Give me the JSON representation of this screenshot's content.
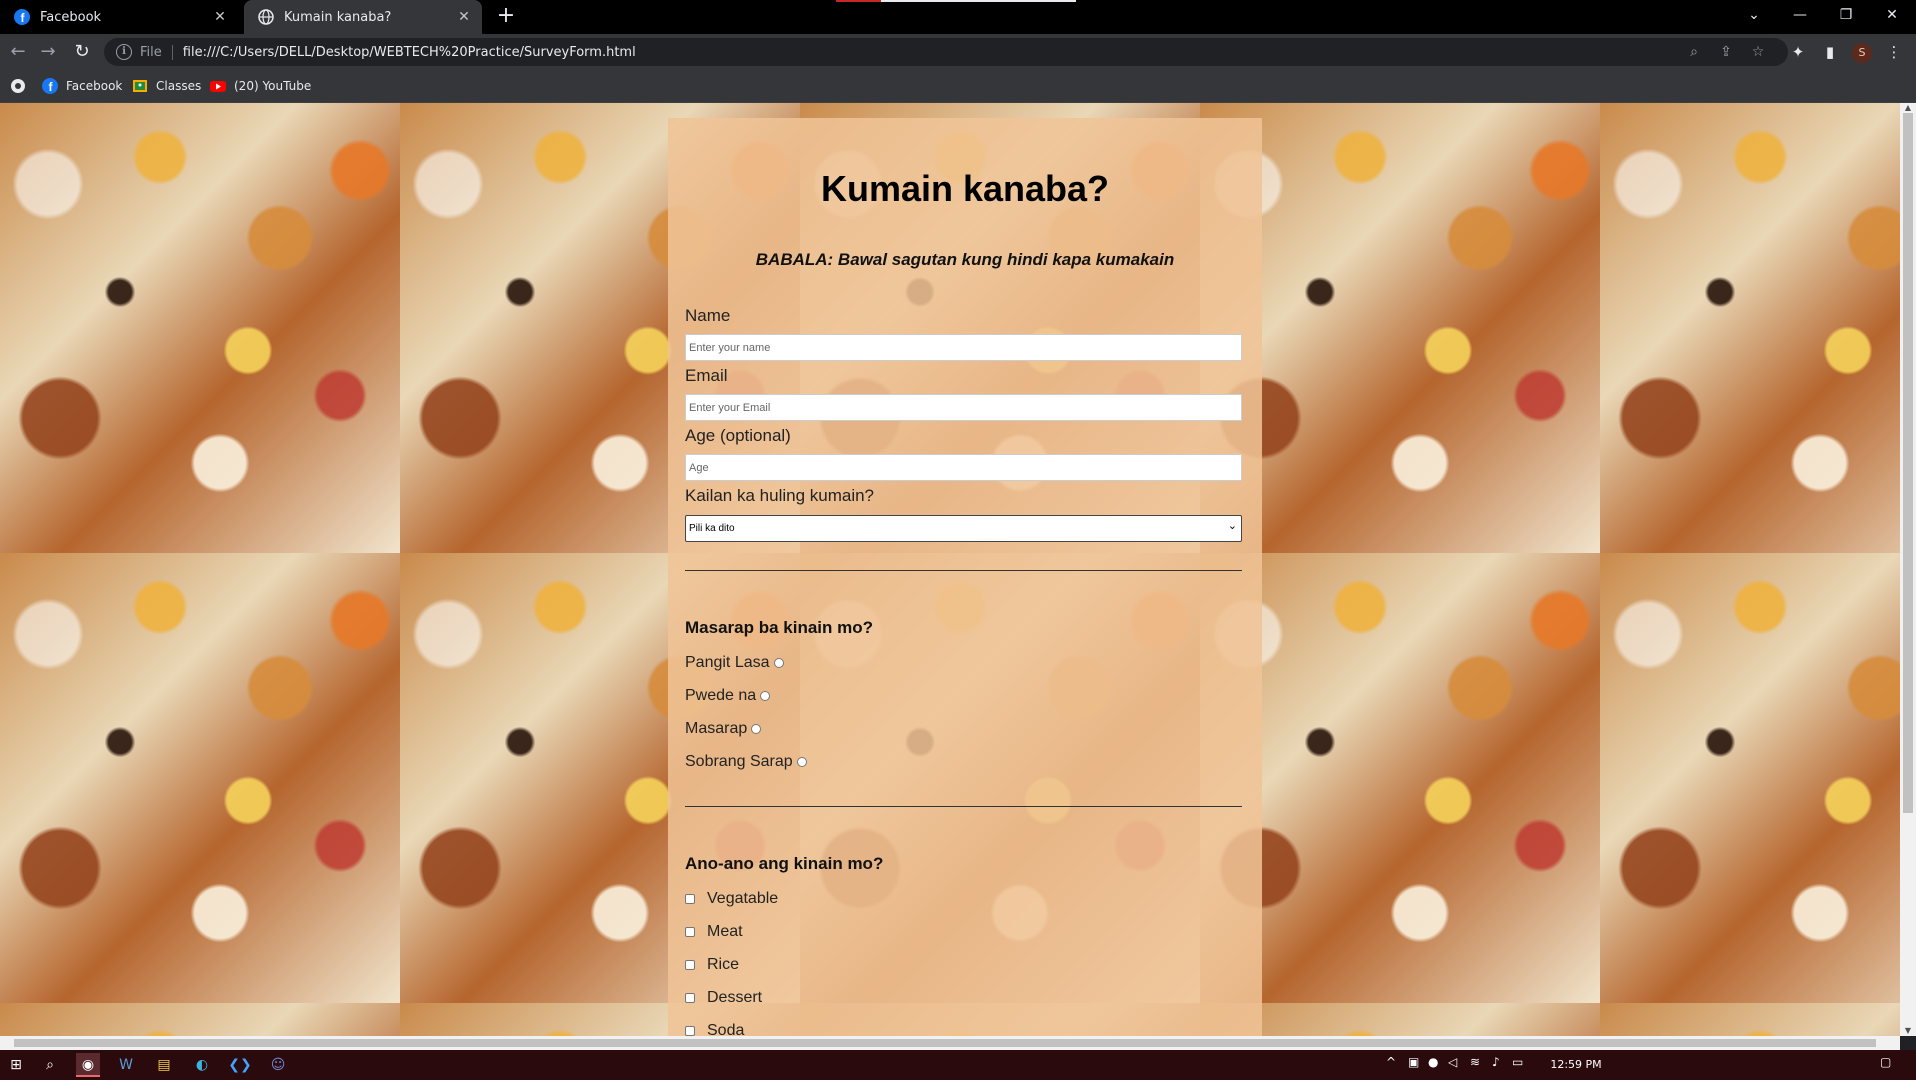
{
  "browser": {
    "tabs": [
      {
        "title": "Facebook",
        "active": false
      },
      {
        "title": "Kumain kanaba?",
        "active": true
      }
    ],
    "url_scheme": "File",
    "url": "file:///C:/Users/DELL/Desktop/WEBTECH%20Practice/SurveyForm.html",
    "profile_initial": "S",
    "bookmarks": [
      {
        "label": "Facebook"
      },
      {
        "label": "Classes"
      },
      {
        "label": "(20) YouTube"
      }
    ]
  },
  "form": {
    "title": "Kumain kanaba?",
    "warning": "BABALA: Bawal sagutan kung hindi kapa kumakain",
    "name_label": "Name",
    "name_placeholder": "Enter your name",
    "email_label": "Email",
    "email_placeholder": "Enter your Email",
    "age_label": "Age (optional)",
    "age_placeholder": "Age",
    "last_ate_label": "Kailan ka huling kumain?",
    "last_ate_selected": "Pili ka dito",
    "taste_question": "Masarap ba kinain mo?",
    "taste_options": [
      "Pangit Lasa",
      "Pwede na",
      "Masarap",
      "Sobrang Sarap"
    ],
    "food_question": "Ano-ano ang kinain mo?",
    "food_options": [
      "Vegatable",
      "Meat",
      "Rice",
      "Dessert",
      "Soda"
    ]
  },
  "taskbar": {
    "clock": "12:59 PM"
  },
  "colors": {
    "card_bg": "#f0c496",
    "tab_active": "#35363a",
    "taskbar": "#2b0a0e"
  }
}
